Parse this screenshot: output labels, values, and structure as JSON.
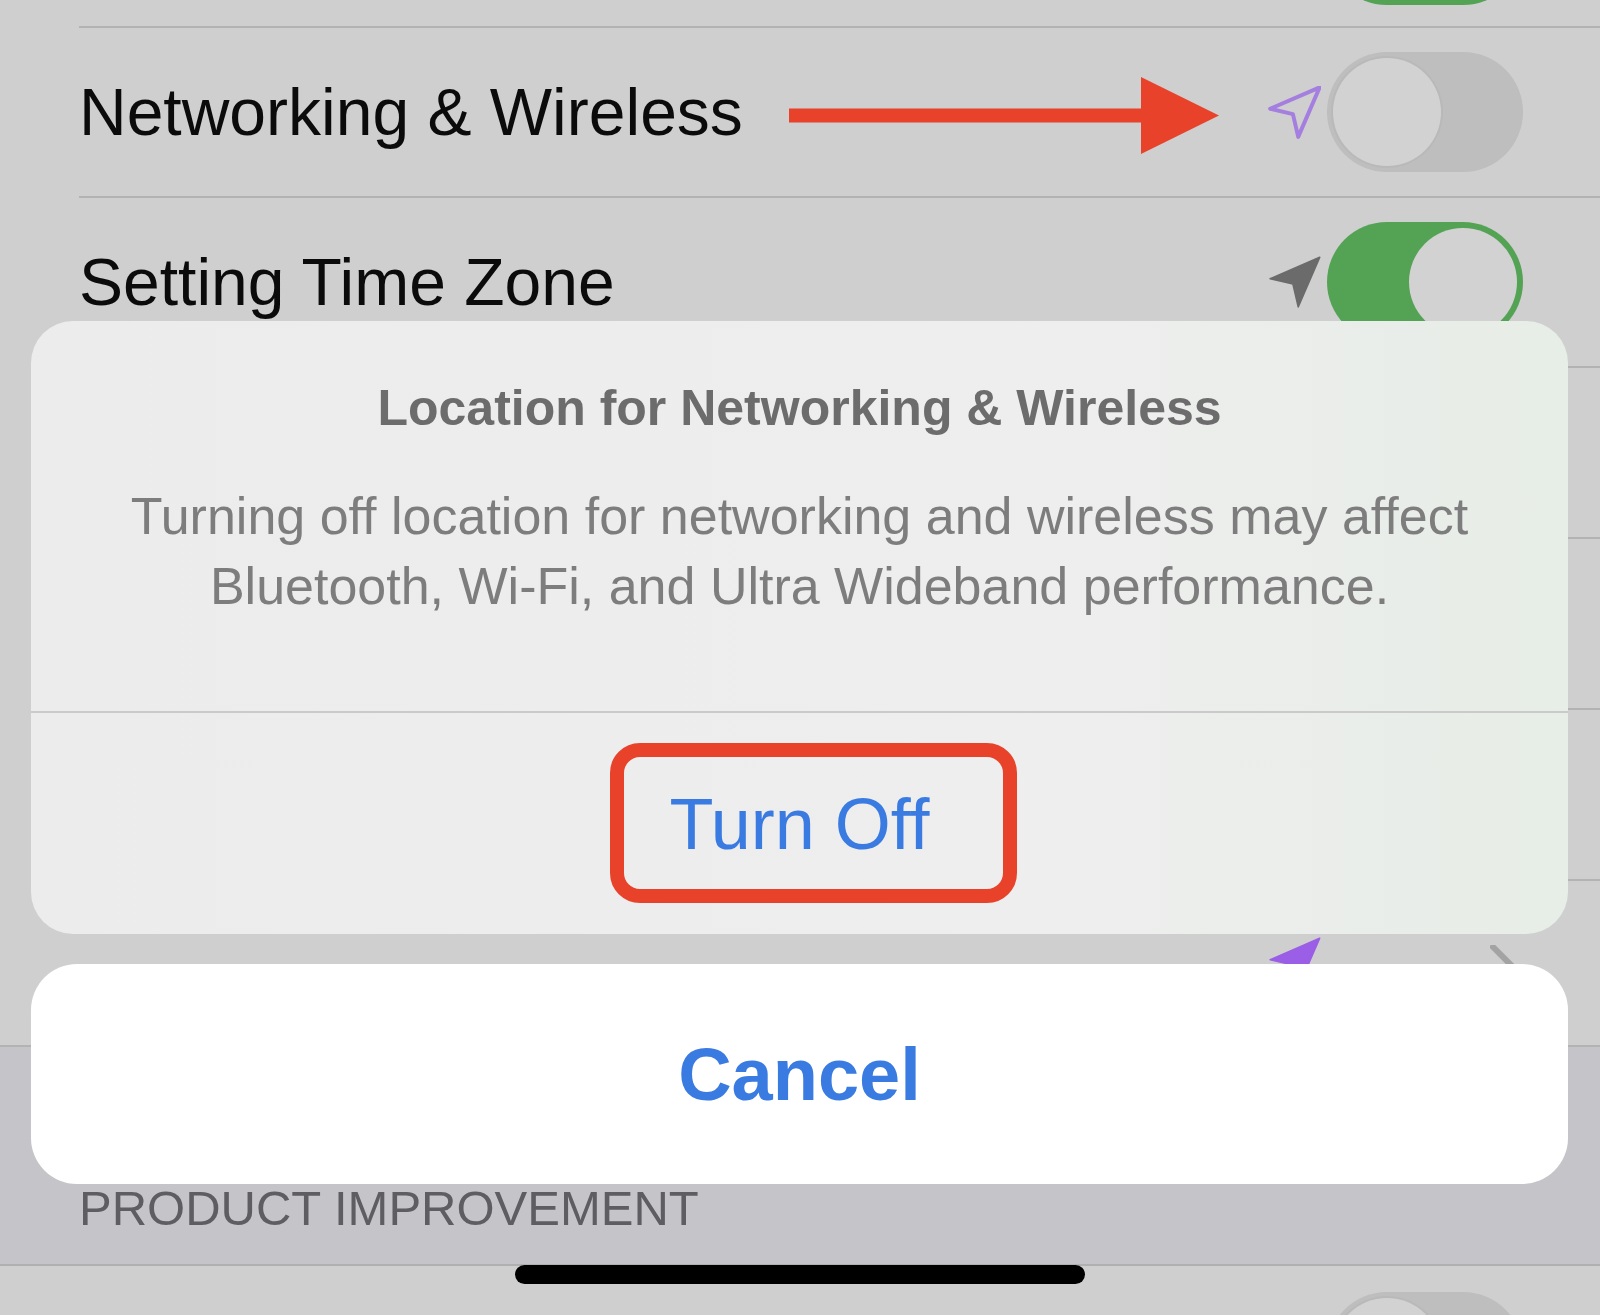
{
  "rows_top": [
    {
      "kind": "toggle",
      "on": true,
      "pointed_at": false
    },
    {
      "kind": "toggle",
      "label": "Networking & Wireless",
      "location_icon": {
        "kind": "outline",
        "color": "#a47fe0"
      },
      "on": false,
      "pointed_at": true
    },
    {
      "kind": "toggle",
      "label": "Setting Time Zone",
      "location_icon": {
        "kind": "filled",
        "color": "#6b6b6b"
      },
      "on": true,
      "pointed_at": false
    }
  ],
  "rows_bottom": [
    {
      "kind": "disclosure",
      "location_icon": {
        "kind": "filled",
        "color": "#9b5ee6"
      },
      "pointed_at": false
    }
  ],
  "section_header": "PRODUCT IMPROVEMENT",
  "section_rows": [
    {
      "kind": "toggle",
      "on": false
    }
  ],
  "action_sheet": {
    "title": "Location for Networking & Wireless",
    "message": "Turning off location for networking and wireless may affect Bluetooth, Wi-Fi, and Ultra Wideband performance.",
    "actions": [
      {
        "label": "Turn Off",
        "framed": true
      }
    ],
    "cancel": "Cancel"
  }
}
